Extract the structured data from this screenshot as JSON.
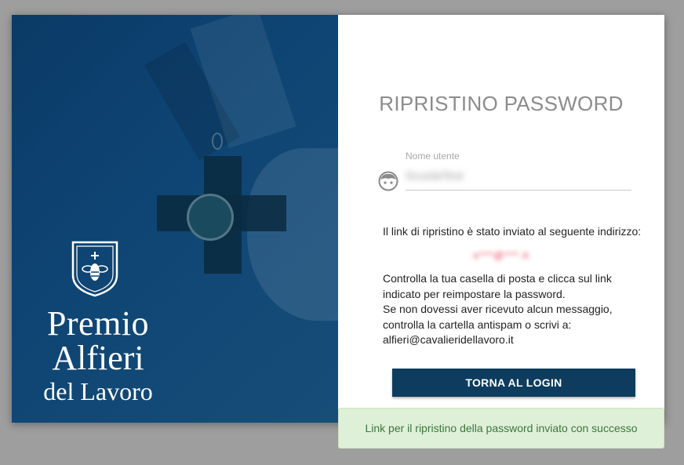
{
  "brand": {
    "line1": "Premio",
    "line2": "Alfieri",
    "line3": "del Lavoro"
  },
  "form": {
    "title": "RIPRISTINO PASSWORD",
    "username_label": "Nome utente",
    "username_value": "ScuolaTest",
    "sent_message": "Il link di ripristino è stato inviato al seguente indirizzo:",
    "email_masked": "s***@***.it",
    "instructions": [
      "Controlla la tua casella di posta e clicca sul link",
      "indicato per reimpostare la password.",
      "Se non dovessi aver ricevuto alcun messaggio,",
      "controlla la cartella antispam o scrivi a:",
      "alfieri@cavalieridellavoro.it"
    ],
    "back_button": "TORNA AL LOGIN"
  },
  "toast": {
    "message": "Link per il ripristino della password inviato con successo"
  },
  "icons": {
    "user": "face-icon",
    "emblem": "bee-shield-icon"
  },
  "colors": {
    "primary": "#0d3c5e",
    "toast_bg": "#dff0d8",
    "toast_text": "#3c763d"
  }
}
